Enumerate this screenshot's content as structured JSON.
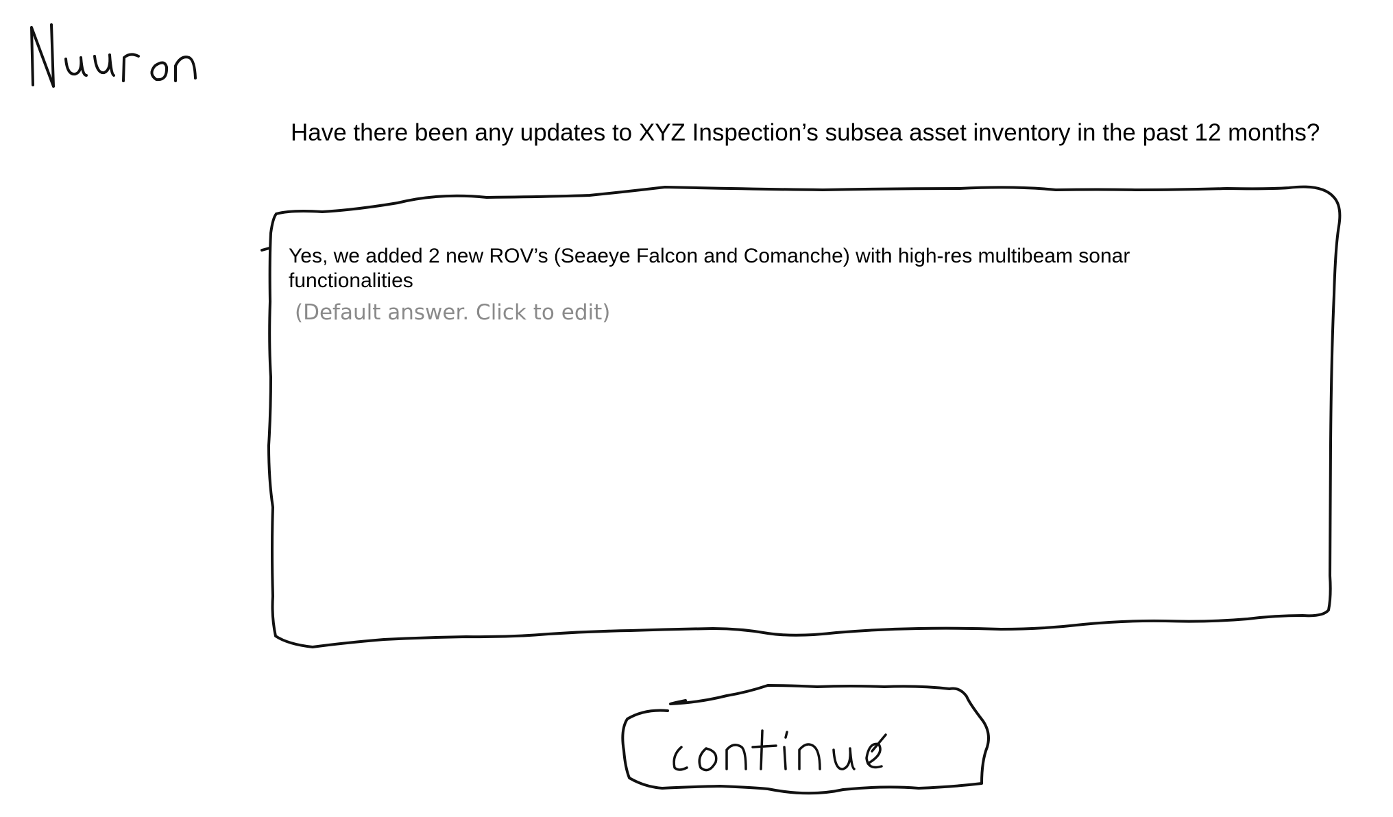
{
  "brand": {
    "name": "Nuuron"
  },
  "question": {
    "text": "Have there been any updates to XYZ Inspection’s subsea asset inventory in the past 12 months?"
  },
  "answer": {
    "value": "Yes, we added 2 new ROV’s (Seaeye Falcon and Comanche) with high-res multibeam sonar functionalities",
    "hint": "(Default answer. Click to edit)"
  },
  "actions": {
    "continue_label": "continue"
  }
}
